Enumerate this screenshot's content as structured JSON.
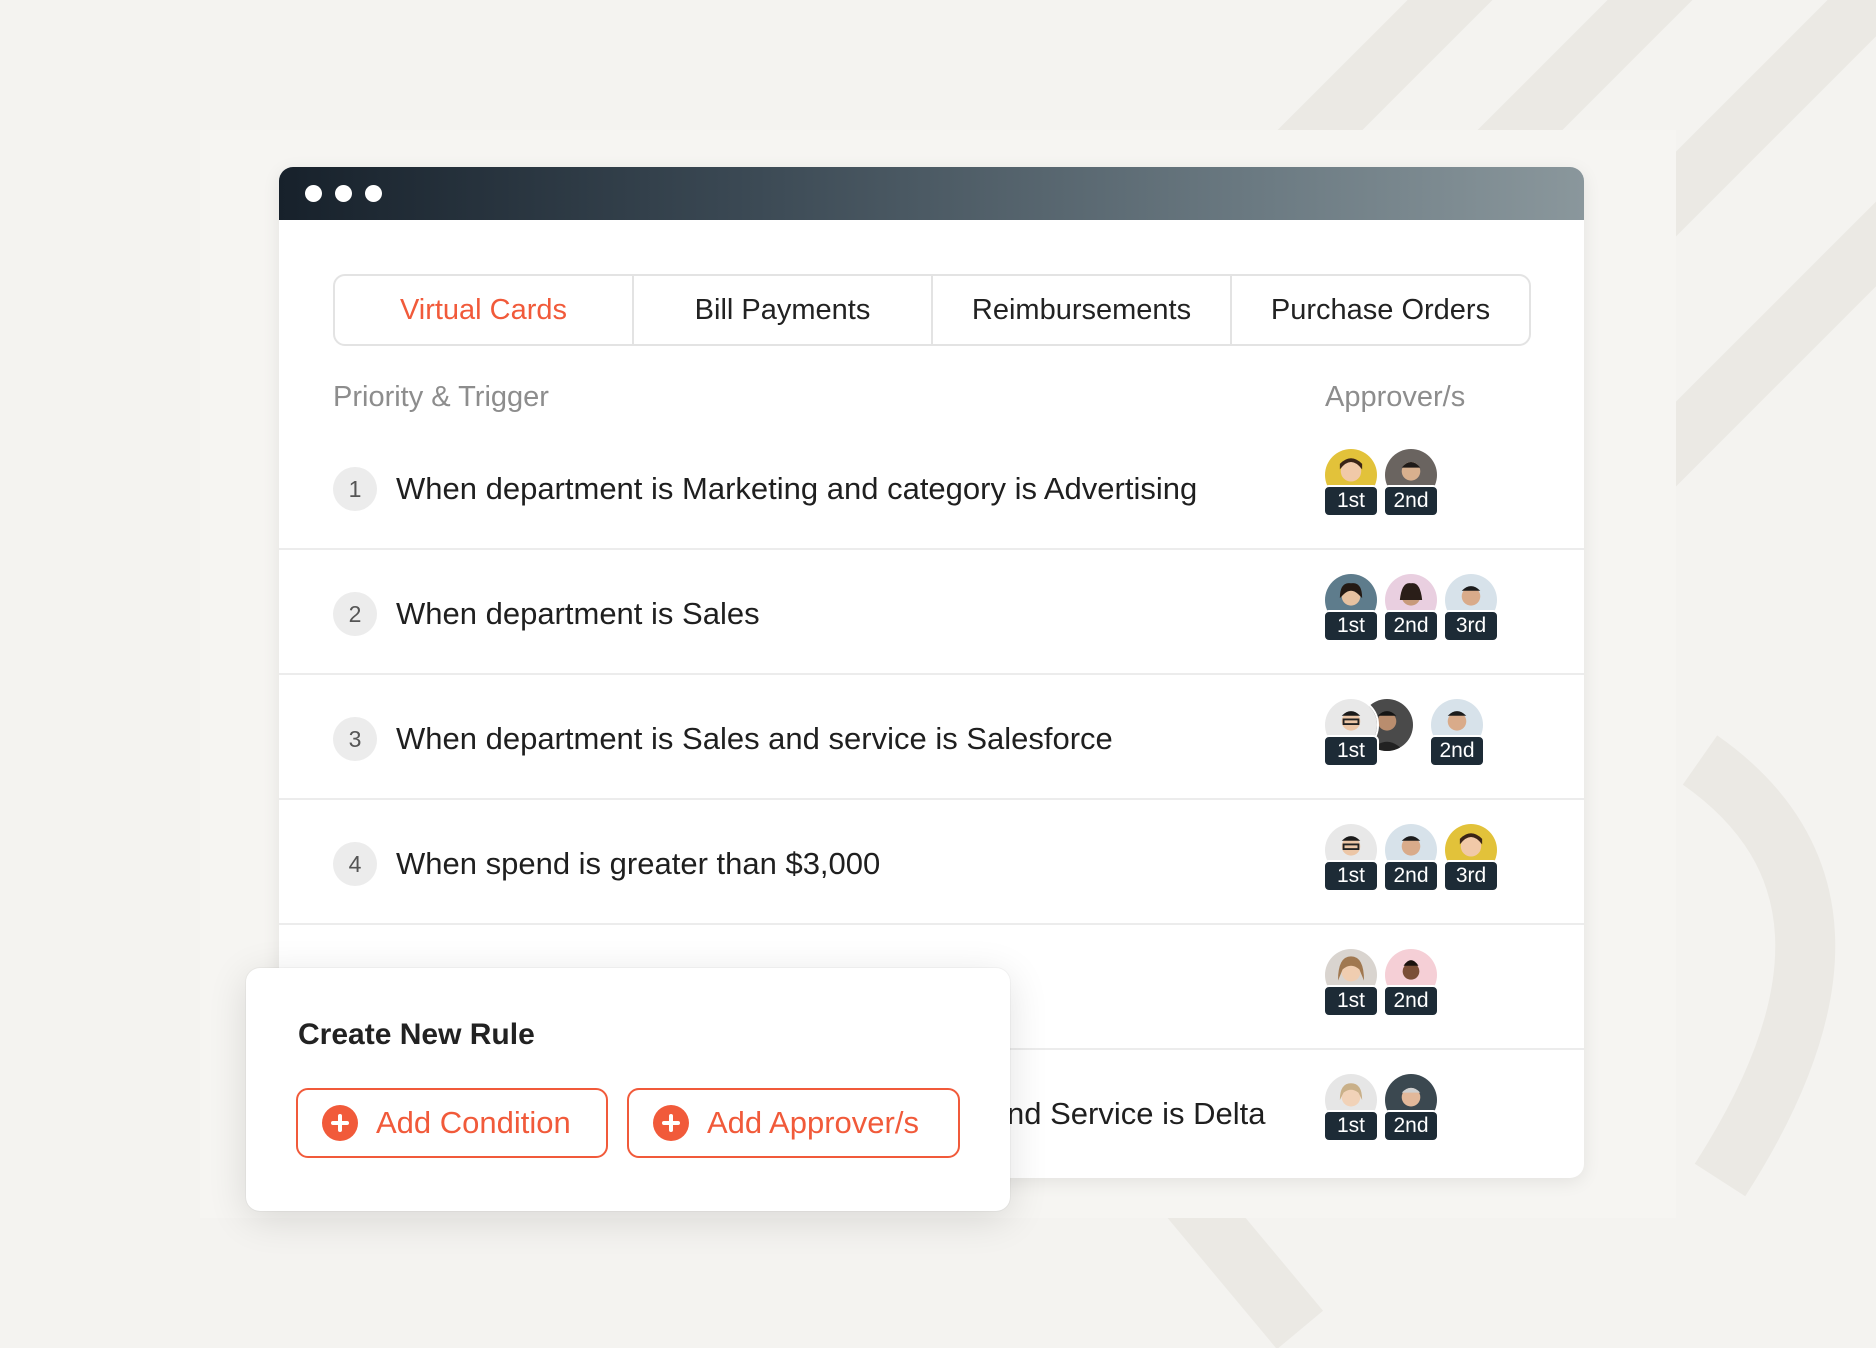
{
  "tabs": [
    {
      "label": "Virtual Cards",
      "active": true
    },
    {
      "label": "Bill Payments",
      "active": false
    },
    {
      "label": "Reimbursements",
      "active": false
    },
    {
      "label": "Purchase Orders",
      "active": false
    }
  ],
  "columns": {
    "left": "Priority & Trigger",
    "right": "Approver/s"
  },
  "rules": [
    {
      "number": "1",
      "trigger": "When department is Marketing and category is Advertising",
      "approvers": [
        "1st",
        "2nd"
      ]
    },
    {
      "number": "2",
      "trigger": "When department is Sales",
      "approvers": [
        "1st",
        "2nd",
        "3rd"
      ]
    },
    {
      "number": "3",
      "trigger": "When department is Sales and service is Salesforce",
      "approvers": [
        "1st",
        "2nd"
      ]
    },
    {
      "number": "4",
      "trigger": "When spend is greater than $3,000",
      "approvers": [
        "1st",
        "2nd",
        "3rd"
      ]
    },
    {
      "number": "",
      "trigger": "",
      "approvers": [
        "1st",
        "2nd"
      ]
    },
    {
      "number": "",
      "trigger": "nd Service is Delta",
      "approvers": [
        "1st",
        "2nd"
      ]
    }
  ],
  "popup": {
    "title": "Create New Rule",
    "add_condition": "Add Condition",
    "add_approvers": "Add Approver/s"
  },
  "colors": {
    "accent": "#f15a3a",
    "badge": "#1d2b36",
    "titlebar": "#17212b"
  }
}
